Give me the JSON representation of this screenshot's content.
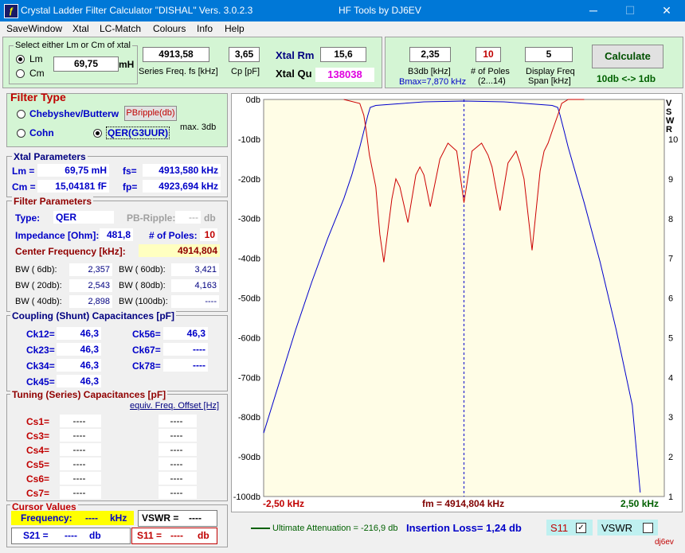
{
  "window": {
    "title": "Crystal Ladder Filter Calculator  \"DISHAL\"  Vers. 3.0.2.3",
    "subtitle": "HF Tools by DJ6EV",
    "minimize": "─",
    "maximize": "☐",
    "close": "✕"
  },
  "menu": [
    "SaveWindow",
    "Xtal",
    "LC-Match",
    "Colours",
    "Info",
    "Help"
  ],
  "xtal_select": {
    "caption": "Select either Lm or Cm of xtal",
    "lm_label": "Lm",
    "cm_label": "Cm",
    "value": "69,75",
    "unit": "mH",
    "selected": "Lm"
  },
  "top_fields": {
    "series_freq_value": "4913,58",
    "series_freq_label": "Series Freq. fs [kHz]",
    "cp_value": "3,65",
    "cp_label": "Cp [pF]",
    "xtal_rm_label": "Xtal Rm",
    "xtal_rm_value": "15,6",
    "xtal_qu_label": "Xtal Qu",
    "xtal_qu_value": "138038"
  },
  "calc_panel": {
    "b3db_value": "2,35",
    "b3db_label": "B3db [kHz]",
    "bmax_label": "Bmax=7,870 kHz",
    "poles_value": "10",
    "poles_label": "# of Poles",
    "poles_range": "(2...14)",
    "span_value": "5",
    "span_label1": "Display Freq",
    "span_label2": "Span [kHz]",
    "calculate_label": "Calculate",
    "range_label": "10db <-> 1db"
  },
  "filter_type": {
    "title": "Filter Type",
    "chebyshev_label": "Chebyshev/Butterw",
    "pbripple_button": "PBripple(db)",
    "cohn_label": "Cohn",
    "qer_label": "QER(G3UUR)",
    "max3db_label": "max. 3db",
    "selected": "QER"
  },
  "xtal_params": {
    "title": "Xtal Parameters",
    "lm_label": "Lm =",
    "lm_value": "69,75 mH",
    "fs_label": "fs=",
    "fs_value": "4913,580 kHz",
    "cm_label": "Cm =",
    "cm_value": "15,04181  fF",
    "fp_label": "fp=",
    "fp_value": "4923,694 kHz"
  },
  "filter_params": {
    "title": "Filter Parameters",
    "type_label": "Type:",
    "type_value": "QER",
    "pbripple_label": "PB-Ripple:",
    "pbripple_value": "---",
    "pbripple_unit": "db",
    "impedance_label": "Impedance [Ohm]:",
    "impedance_value": "481,8",
    "poles_label": "# of Poles:",
    "poles_value": "10",
    "center_label": "Center Frequency [kHz]:",
    "center_value": "4914,804",
    "bw": [
      {
        "label": "BW (  6db):",
        "value": "2,357"
      },
      {
        "label": "BW ( 60db):",
        "value": "3,421"
      },
      {
        "label": "BW ( 20db):",
        "value": "2,543"
      },
      {
        "label": "BW ( 80db):",
        "value": "4,163"
      },
      {
        "label": "BW ( 40db):",
        "value": "2,898"
      },
      {
        "label": "BW (100db):",
        "value": "----"
      }
    ]
  },
  "coupling": {
    "title": "Coupling (Shunt) Capacitances [pF]",
    "items": [
      {
        "label": "Ck12=",
        "value": "46,3"
      },
      {
        "label": "Ck56=",
        "value": "46,3"
      },
      {
        "label": "Ck23=",
        "value": "46,3"
      },
      {
        "label": "Ck67=",
        "value": "----"
      },
      {
        "label": "Ck34=",
        "value": "46,3"
      },
      {
        "label": "Ck78=",
        "value": "----"
      },
      {
        "label": "Ck45=",
        "value": "46,3"
      }
    ]
  },
  "tuning": {
    "title": "Tuning (Series) Capacitances [pF]",
    "offset_link": "equiv. Freq. Offset [Hz]",
    "items": [
      {
        "label": "Cs1=",
        "value": "----",
        "offset": "----"
      },
      {
        "label": "Cs3=",
        "value": "----",
        "offset": "----"
      },
      {
        "label": "Cs4=",
        "value": "----",
        "offset": "----"
      },
      {
        "label": "Cs5=",
        "value": "----",
        "offset": "----"
      },
      {
        "label": "Cs6=",
        "value": "----",
        "offset": "----"
      },
      {
        "label": "Cs7=",
        "value": "----",
        "offset": "----"
      }
    ]
  },
  "cursor": {
    "title": "Cursor Values",
    "freq_label": "Frequency:",
    "freq_value": "----",
    "freq_unit": "kHz",
    "vswr_label": "VSWR =",
    "vswr_value": "----",
    "s21_label": "S21 =",
    "s21_value": "----",
    "s21_unit": "db",
    "s11_label": "S11 =",
    "s11_value": "----",
    "s11_unit": "db"
  },
  "plot_footer": {
    "legend_text": "Ultimate Attenuation = -216,9 db",
    "insertion_loss": "Insertion Loss= 1,24 db",
    "s11_label": "S11",
    "s11_checked": "✓",
    "vswr_label": "VSWR",
    "signature": "dj6ev"
  },
  "colors": {
    "s21": "#0000cc",
    "s11": "#cc0000",
    "plot_bg": "#fffde6",
    "panel_green": "#d4f5d4",
    "accent": "#0078d7"
  },
  "chart_data": {
    "type": "line",
    "x_left_label": "-2,50 kHz",
    "x_center_label": "fm = 4914,804 kHz",
    "x_right_label": "2,50 kHz",
    "right_axis_title": [
      "V",
      "S",
      "W",
      "R"
    ],
    "x_range": [
      -2.5,
      2.5
    ],
    "y_range": [
      -100,
      0
    ],
    "y_ticks": [
      "0db",
      "-10db",
      "-20db",
      "-30db",
      "-40db",
      "-50db",
      "-60db",
      "-70db",
      "-80db",
      "-90db",
      "-100db"
    ],
    "vswr_ticks": [
      "10",
      "9",
      "8",
      "7",
      "6",
      "5",
      "4",
      "3",
      "2",
      "1"
    ],
    "series": [
      {
        "name": "S21",
        "x": [
          -2.5,
          -2.3,
          -2.1,
          -1.9,
          -1.7,
          -1.5,
          -1.4,
          -1.3,
          -1.25,
          -1.2,
          -1.17,
          -1.1,
          -0.9,
          -0.5,
          0,
          0.5,
          0.9,
          1.1,
          1.17,
          1.2,
          1.25,
          1.3,
          1.4,
          1.5,
          1.7,
          1.9,
          2.1,
          2.2
        ],
        "y": [
          -84,
          -71,
          -58,
          -46,
          -35,
          -25,
          -19,
          -12,
          -8,
          -4,
          -2,
          -1.5,
          -1.2,
          -0.6,
          -0.4,
          -0.6,
          -1.2,
          -1.5,
          -2,
          -4,
          -8,
          -12,
          -19,
          -26,
          -41,
          -58,
          -77,
          -99
        ]
      },
      {
        "name": "S11",
        "x": [
          -1.5,
          -1.3,
          -1.25,
          -1.22,
          -1.18,
          -1.1,
          -1.05,
          -1.0,
          -0.9,
          -0.85,
          -0.8,
          -0.7,
          -0.6,
          -0.55,
          -0.5,
          -0.42,
          -0.3,
          -0.2,
          -0.09,
          0,
          0.1,
          0.22,
          0.3,
          0.35,
          0.45,
          0.55,
          0.65,
          0.7,
          0.75,
          0.85,
          0.95,
          1.0,
          1.05,
          1.1,
          1.17,
          1.22,
          1.3,
          1.5
        ],
        "y": [
          0,
          -1,
          -4,
          -8,
          -14,
          -22,
          -34,
          -41,
          -25,
          -20,
          -22,
          -31,
          -19,
          -17,
          -19,
          -27,
          -15,
          -11,
          -13,
          -26,
          -13,
          -11,
          -14,
          -17,
          -28,
          -16,
          -13,
          -16,
          -20,
          -38,
          -18,
          -13,
          -11,
          -8,
          -4,
          -1,
          0,
          0
        ]
      }
    ]
  }
}
